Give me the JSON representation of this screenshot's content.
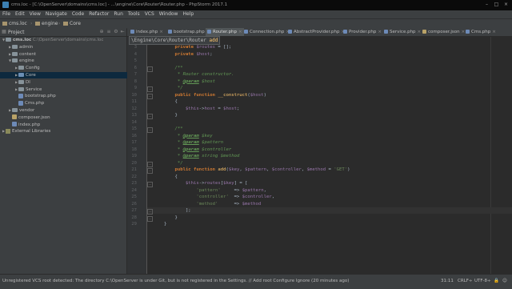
{
  "window": {
    "title": "cms.loc - [C:\\OpenServer\\domains\\cms.loc] - ...\\engine\\Core\\Router\\Router.php - PhpStorm 2017.1"
  },
  "menu": [
    "File",
    "Edit",
    "View",
    "Navigate",
    "Code",
    "Refactor",
    "Run",
    "Tools",
    "VCS",
    "Window",
    "Help"
  ],
  "breadcrumb": [
    "cms.loc",
    "engine",
    "Core"
  ],
  "project_panel": {
    "label": "Project",
    "items": [
      {
        "label": "cms.loc",
        "path": "C:\\OpenServer\\domains\\cms.loc",
        "indent": 0,
        "kind": "folder",
        "expanded": true
      },
      {
        "label": "admin",
        "indent": 1,
        "kind": "folder",
        "expanded": false
      },
      {
        "label": "content",
        "indent": 1,
        "kind": "folder",
        "expanded": false
      },
      {
        "label": "engine",
        "indent": 1,
        "kind": "folder",
        "expanded": true
      },
      {
        "label": "Config",
        "indent": 2,
        "kind": "folder",
        "expanded": false
      },
      {
        "label": "Core",
        "indent": 2,
        "kind": "folder",
        "expanded": false,
        "selected": true
      },
      {
        "label": "DI",
        "indent": 2,
        "kind": "folder",
        "expanded": false
      },
      {
        "label": "Service",
        "indent": 2,
        "kind": "folder",
        "expanded": false
      },
      {
        "label": "bootstrap.php",
        "indent": 2,
        "kind": "php"
      },
      {
        "label": "Cms.php",
        "indent": 2,
        "kind": "php"
      },
      {
        "label": "vendor",
        "indent": 1,
        "kind": "folder",
        "expanded": false
      },
      {
        "label": "composer.json",
        "indent": 1,
        "kind": "json"
      },
      {
        "label": "index.php",
        "indent": 1,
        "kind": "php"
      },
      {
        "label": "External Libraries",
        "indent": 0,
        "kind": "lib",
        "expanded": false
      }
    ]
  },
  "tabs": [
    {
      "label": "index.php",
      "kind": "php"
    },
    {
      "label": "bootstrap.php",
      "kind": "php"
    },
    {
      "label": "Router.php",
      "kind": "php",
      "active": true
    },
    {
      "label": "Connection.php",
      "kind": "php"
    },
    {
      "label": "AbstractProvider.php",
      "kind": "php"
    },
    {
      "label": "Provider.php",
      "kind": "php"
    },
    {
      "label": "Service.php",
      "kind": "php"
    },
    {
      "label": "composer.json",
      "kind": "json"
    },
    {
      "label": "Cms.php",
      "kind": "php"
    }
  ],
  "tooltip": {
    "namespace": "\\Engine\\Core\\Router\\Router",
    "method": "add"
  },
  "code": {
    "current_line": 31,
    "lines": [
      {
        "n": "3",
        "tokens": [
          {
            "c": "kw",
            "t": "    private "
          },
          {
            "c": "var",
            "t": "$routes"
          },
          {
            "c": "plain",
            "t": " = [];"
          }
        ]
      },
      {
        "n": "4",
        "tokens": [
          {
            "c": "kw",
            "t": "    private "
          },
          {
            "c": "var",
            "t": "$host"
          },
          {
            "c": "plain",
            "t": ";"
          }
        ]
      },
      {
        "n": "5",
        "tokens": []
      },
      {
        "n": "6",
        "tokens": [
          {
            "c": "cm",
            "t": "    /**"
          }
        ]
      },
      {
        "n": "7",
        "tokens": [
          {
            "c": "cm",
            "t": "     * Router constructor."
          }
        ]
      },
      {
        "n": "8",
        "tokens": [
          {
            "c": "cm",
            "t": "     * "
          },
          {
            "c": "tag",
            "t": "@param"
          },
          {
            "c": "cm",
            "t": " $host"
          }
        ]
      },
      {
        "n": "9",
        "tokens": [
          {
            "c": "cm",
            "t": "     */"
          }
        ]
      },
      {
        "n": "10",
        "tokens": [
          {
            "c": "kw",
            "t": "    public function "
          },
          {
            "c": "fn",
            "t": "__construct"
          },
          {
            "c": "plain",
            "t": "("
          },
          {
            "c": "var",
            "t": "$host"
          },
          {
            "c": "plain",
            "t": ")"
          }
        ]
      },
      {
        "n": "11",
        "tokens": [
          {
            "c": "plain",
            "t": "    {"
          }
        ]
      },
      {
        "n": "12",
        "tokens": [
          {
            "c": "var",
            "t": "        $this"
          },
          {
            "c": "plain",
            "t": "->"
          },
          {
            "c": "var",
            "t": "host"
          },
          {
            "c": "plain",
            "t": " = "
          },
          {
            "c": "var",
            "t": "$host"
          },
          {
            "c": "plain",
            "t": ";"
          }
        ]
      },
      {
        "n": "13",
        "tokens": [
          {
            "c": "plain",
            "t": "    }"
          }
        ]
      },
      {
        "n": "14",
        "tokens": []
      },
      {
        "n": "15",
        "tokens": [
          {
            "c": "cm",
            "t": "    /**"
          }
        ]
      },
      {
        "n": "16",
        "tokens": [
          {
            "c": "cm",
            "t": "     * "
          },
          {
            "c": "tag",
            "t": "@param"
          },
          {
            "c": "cm",
            "t": " $key"
          }
        ]
      },
      {
        "n": "17",
        "tokens": [
          {
            "c": "cm",
            "t": "     * "
          },
          {
            "c": "tag",
            "t": "@param"
          },
          {
            "c": "cm",
            "t": " $pattern"
          }
        ]
      },
      {
        "n": "18",
        "tokens": [
          {
            "c": "cm",
            "t": "     * "
          },
          {
            "c": "tag",
            "t": "@param"
          },
          {
            "c": "cm",
            "t": " $controller"
          }
        ]
      },
      {
        "n": "19",
        "tokens": [
          {
            "c": "cm",
            "t": "     * "
          },
          {
            "c": "tag",
            "t": "@param"
          },
          {
            "c": "cm",
            "t": " string $method"
          }
        ]
      },
      {
        "n": "20",
        "tokens": [
          {
            "c": "cm",
            "t": "     */"
          }
        ]
      },
      {
        "n": "21",
        "tokens": [
          {
            "c": "kw",
            "t": "    public function "
          },
          {
            "c": "fn",
            "t": "add"
          },
          {
            "c": "plain",
            "t": "("
          },
          {
            "c": "var",
            "t": "$key"
          },
          {
            "c": "plain",
            "t": ", "
          },
          {
            "c": "var",
            "t": "$pattern"
          },
          {
            "c": "plain",
            "t": ", "
          },
          {
            "c": "var",
            "t": "$controller"
          },
          {
            "c": "plain",
            "t": ", "
          },
          {
            "c": "var",
            "t": "$method"
          },
          {
            "c": "plain",
            "t": " = "
          },
          {
            "c": "str",
            "t": "'GET'"
          },
          {
            "c": "plain",
            "t": ")"
          }
        ]
      },
      {
        "n": "22",
        "tokens": [
          {
            "c": "plain",
            "t": "    {"
          }
        ]
      },
      {
        "n": "23",
        "tokens": [
          {
            "c": "var",
            "t": "        $this"
          },
          {
            "c": "plain",
            "t": "->"
          },
          {
            "c": "var",
            "t": "routes"
          },
          {
            "c": "plain",
            "t": "["
          },
          {
            "c": "var",
            "t": "$key"
          },
          {
            "c": "plain",
            "t": "] = ["
          }
        ]
      },
      {
        "n": "24",
        "tokens": [
          {
            "c": "str",
            "t": "            'pattern'"
          },
          {
            "c": "plain",
            "t": "     => "
          },
          {
            "c": "var",
            "t": "$pattern"
          },
          {
            "c": "plain",
            "t": ","
          }
        ]
      },
      {
        "n": "25",
        "tokens": [
          {
            "c": "str",
            "t": "            'controller'"
          },
          {
            "c": "plain",
            "t": "  => "
          },
          {
            "c": "var",
            "t": "$controller"
          },
          {
            "c": "plain",
            "t": ","
          }
        ]
      },
      {
        "n": "26",
        "tokens": [
          {
            "c": "str",
            "t": "            'method'"
          },
          {
            "c": "plain",
            "t": "      => "
          },
          {
            "c": "var",
            "t": "$method"
          }
        ]
      },
      {
        "n": "27",
        "tokens": [
          {
            "c": "plain",
            "t": "        ];"
          }
        ]
      },
      {
        "n": "28",
        "tokens": [
          {
            "c": "plain",
            "t": "    }"
          }
        ]
      },
      {
        "n": "29",
        "tokens": [
          {
            "c": "plain",
            "t": "}"
          }
        ]
      }
    ]
  },
  "status": {
    "message": "Unregistered VCS root detected: The directory C:\\OpenServer is under Git, but is not registered in the Settings. // Add root  Configure  Ignore (20 minutes ago)",
    "position": "31:11",
    "line_sep": "CRLF÷",
    "encoding": "UTF-8÷"
  }
}
